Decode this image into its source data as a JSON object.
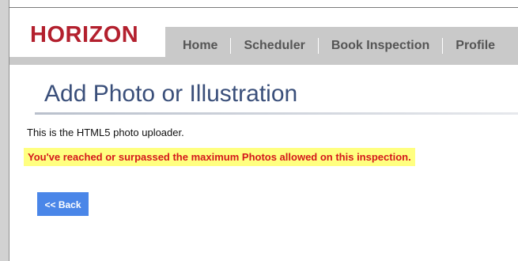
{
  "header": {
    "logo_text": "HORIZON",
    "nav": [
      {
        "label": "Home"
      },
      {
        "label": "Scheduler"
      },
      {
        "label": "Book Inspection"
      },
      {
        "label": "Profile"
      }
    ]
  },
  "main": {
    "title": "Add Photo or Illustration",
    "intro_text": "This is the HTML5 photo uploader.",
    "warning_text": "You've reached or surpassed the maximum Photos allowed on this inspection.",
    "back_label": "<< Back"
  },
  "colors": {
    "brand_red": "#b3202e",
    "title_blue": "#3a4f7a",
    "warning_red": "#d4171b",
    "warning_highlight": "#ffff80",
    "button_blue": "#4a86e8"
  }
}
